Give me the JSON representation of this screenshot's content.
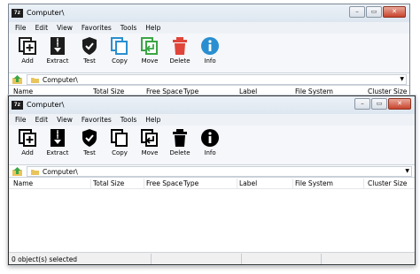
{
  "windows": [
    {
      "title": "Computer\\",
      "app_icon": "7z",
      "controls": [
        "minimize-icon",
        "maximize-icon",
        "close-icon"
      ],
      "menu": [
        "File",
        "Edit",
        "View",
        "Favorites",
        "Tools",
        "Help"
      ],
      "toolbar": [
        {
          "label": "Add",
          "icon": "add-icon",
          "color": "#1c1c1c"
        },
        {
          "label": "Extract",
          "icon": "extract-icon",
          "color": "#1c1c1c"
        },
        {
          "label": "Test",
          "icon": "test-shield-icon",
          "color": "#1c1c1c"
        },
        {
          "label": "Copy",
          "icon": "copy-icon",
          "color": "#2a8fd0"
        },
        {
          "label": "Move",
          "icon": "move-icon",
          "color": "#3aa645"
        },
        {
          "label": "Delete",
          "icon": "delete-icon",
          "color": "#e0453a"
        },
        {
          "label": "Info",
          "icon": "info-icon",
          "color": "#2a8fd0"
        }
      ],
      "address": "Computer\\",
      "columns": [
        "Name",
        "Total Size",
        "Free Space",
        "Type",
        "Label",
        "File System",
        "Cluster Size"
      ]
    },
    {
      "title": "Computer\\",
      "app_icon": "7z",
      "controls": [
        "minimize-icon",
        "maximize-icon",
        "close-icon"
      ],
      "menu": [
        "File",
        "Edit",
        "View",
        "Favorites",
        "Tools",
        "Help"
      ],
      "toolbar": [
        {
          "label": "Add",
          "icon": "add-icon",
          "color": "#000000"
        },
        {
          "label": "Extract",
          "icon": "extract-icon",
          "color": "#000000"
        },
        {
          "label": "Test",
          "icon": "test-shield-icon",
          "color": "#000000"
        },
        {
          "label": "Copy",
          "icon": "copy-icon",
          "color": "#000000"
        },
        {
          "label": "Move",
          "icon": "move-icon",
          "color": "#000000"
        },
        {
          "label": "Delete",
          "icon": "delete-icon",
          "color": "#000000"
        },
        {
          "label": "Info",
          "icon": "info-icon",
          "color": "#000000"
        }
      ],
      "address": "Computer\\",
      "columns": [
        "Name",
        "Total Size",
        "Free Space",
        "Type",
        "Label",
        "File System",
        "Cluster Size"
      ],
      "status": "0 object(s) selected"
    }
  ]
}
